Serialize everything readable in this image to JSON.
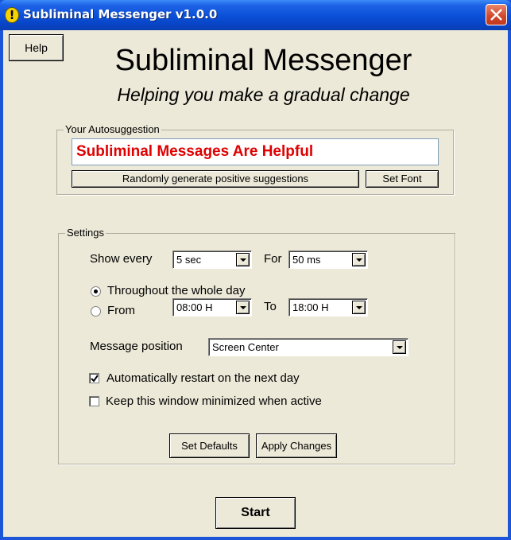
{
  "window": {
    "title": "Subliminal Messenger v1.0.0",
    "title_icon_glyph": "!",
    "close_icon": "close-icon"
  },
  "help_label": "Help",
  "header": {
    "title": "Subliminal Messenger",
    "subtitle": "Helping you make a gradual change"
  },
  "autosuggestion": {
    "legend": "Your Autosuggestion",
    "text": "Subliminal Messages Are Helpful",
    "text_color": "#e00000",
    "random_button": "Randomly generate positive suggestions",
    "font_button": "Set Font"
  },
  "settings": {
    "legend": "Settings",
    "show_every_label": "Show every",
    "show_every_value": "5 sec",
    "for_label": "For",
    "for_value": "50 ms",
    "radio_whole_day": "Throughout the whole day",
    "radio_from": "From",
    "from_value": "08:00 H",
    "to_label": "To",
    "to_value": "18:00 H",
    "position_label": "Message position",
    "position_value": "Screen Center",
    "auto_restart": "Automatically restart on the next day",
    "keep_minimized": "Keep this window minimized when active",
    "defaults_button": "Set Defaults",
    "apply_button": "Apply Changes"
  },
  "start_label": "Start"
}
